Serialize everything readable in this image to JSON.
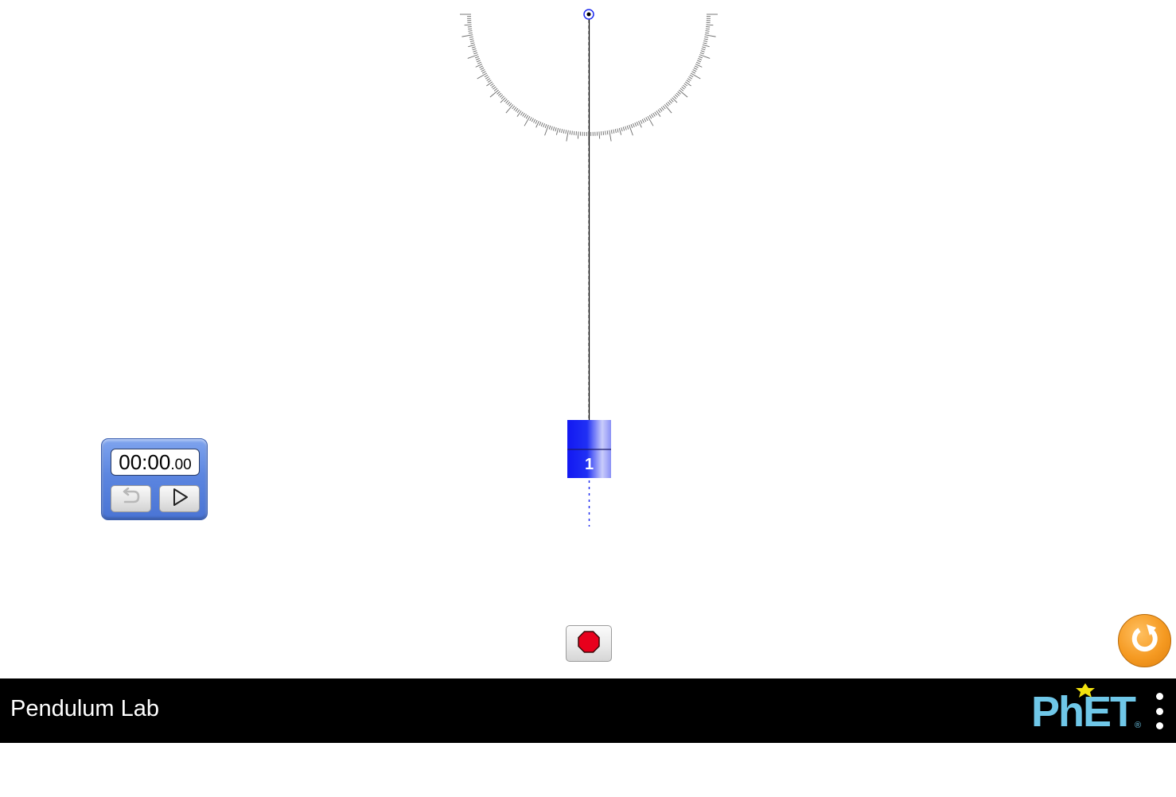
{
  "window": {
    "title": "Pendulum Lab"
  },
  "pendulum": {
    "mass_label": "1",
    "mass_color": "#1e2bf0"
  },
  "stopwatch": {
    "time_main": "00:00",
    "time_fraction": ".00",
    "reset_icon": "undo-arrow-icon",
    "play_icon": "play-icon"
  },
  "controls": {
    "stop_icon": "stop-octagon-icon",
    "reset_all_icon": "reset-all-icon"
  },
  "navbar": {
    "title": "Pendulum Lab",
    "logo_text": "PhET",
    "logo_registered": "®",
    "menu_icon": "kebab-menu-icon"
  },
  "colors": {
    "stopwatch_blue": "#5c86e0",
    "reset_orange": "#f59a22",
    "stop_red": "#e8001c",
    "phet_blue": "#6fc7e8",
    "phet_yellow": "#f2e10f"
  }
}
